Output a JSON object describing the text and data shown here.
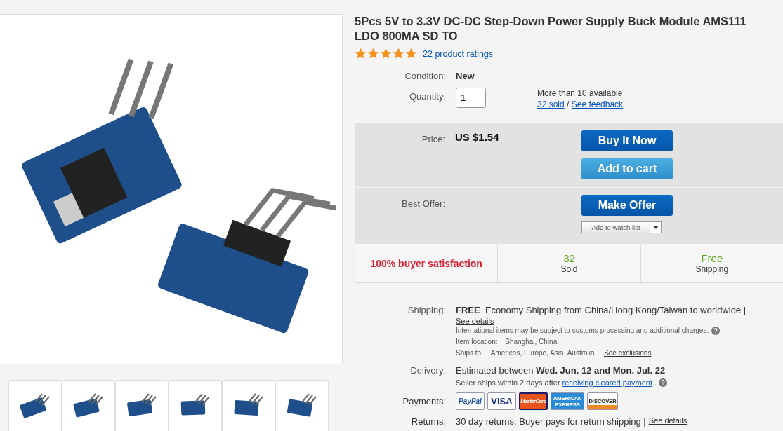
{
  "gallery": {
    "thumbnails": [
      {
        "selected": false
      },
      {
        "selected": false
      },
      {
        "selected": false
      },
      {
        "selected": false
      },
      {
        "selected": false
      },
      {
        "selected": false
      }
    ]
  },
  "product": {
    "title_lines": [
      "5Pcs 5V to 3.3V DC-DC Step-Down Power Supply Buck Module AMS111",
      "LDO 800MA SD TO"
    ],
    "stars": 5,
    "ratings_link": "22 product ratings"
  },
  "condition": {
    "label": "Condition:",
    "value": "New"
  },
  "quantity": {
    "label": "Quantity:",
    "value": "1",
    "available": "More than 10 available",
    "sold_link": "32 sold",
    "separator": "/",
    "feedback_link": "See feedback"
  },
  "price": {
    "label": "Price:",
    "value": "US $1.54",
    "buttons": [
      {
        "label": "Buy It Now",
        "kind": "primary"
      },
      {
        "label": "Add to cart",
        "kind": "secondary"
      }
    ]
  },
  "offer": {
    "label": "Best Offer:",
    "button": "Make Offer",
    "watch": "Add to watch list"
  },
  "stats": [
    {
      "kind": "highlight",
      "value": "100% buyer satisfaction"
    },
    {
      "kind": "pair",
      "value": "32",
      "caption": "Sold"
    },
    {
      "kind": "pair",
      "value": "Free",
      "caption": "Shipping"
    }
  ],
  "shipping": {
    "label": "Shipping:",
    "free": "FREE",
    "text": "Economy Shipping from China/Hong Kong/Taiwan to worldwide |",
    "details_link": "See details",
    "note": "International items may be subject to customs processing and additional charges.",
    "location_label": "Item location:",
    "location": "Shanghai, China",
    "ships_to_label": "Ships to:",
    "ships_to": "Americas, Europe, Asia, Australia",
    "exclusions_link": "See exclusions"
  },
  "delivery": {
    "label": "Delivery:",
    "estimate": "Estimated between **Wed. Jun. 12 and Mon. Jul. 22**",
    "note_prefix": "Seller ships within 2 days after",
    "note_link": "receiving cleared payment",
    "note_suffix": "."
  },
  "payments": {
    "label": "Payments:",
    "methods": [
      {
        "kind": "paypal",
        "text": "PayPal"
      },
      {
        "kind": "visa",
        "text": "VISA"
      },
      {
        "kind": "mastercard",
        "text": "MasterCard"
      },
      {
        "kind": "amex",
        "text": "AMERICAN EXPRESS"
      },
      {
        "kind": "discover",
        "text": "DISCOVER"
      }
    ]
  },
  "returns": {
    "label": "Returns:",
    "text": "30 day returns. Buyer pays for return shipping |",
    "details_link": "See details"
  }
}
